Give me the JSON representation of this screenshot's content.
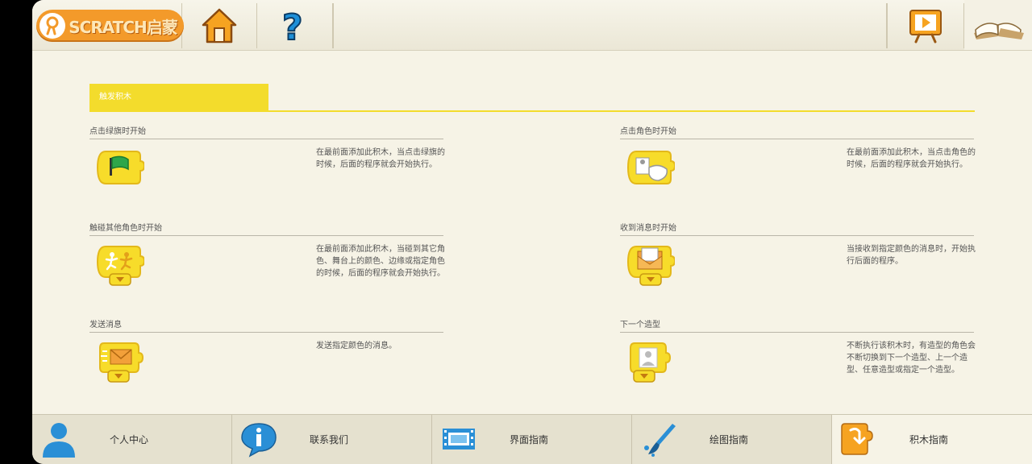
{
  "topbar": {
    "logo_text": "SCRATCH启蒙",
    "home_icon": "home-icon",
    "help_icon": "help-icon",
    "video_icon": "video-icon",
    "book_icon": "book-icon"
  },
  "section": {
    "title": "触发积木"
  },
  "blocks": [
    {
      "title": "点击绿旗时开始",
      "desc": "在最前面添加此积木，当点击绿旗的时候，后面的程序就会开始执行。",
      "icon": "green-flag-block-icon"
    },
    {
      "title": "点击角色时开始",
      "desc": "在最前面添加此积木，当点击角色的时候，后面的程序就会开始执行。",
      "icon": "tap-sprite-block-icon"
    },
    {
      "title": "触碰其他角色时开始",
      "desc": "在最前面添加此积木，当碰到其它角色、舞台上的颜色、边缘或指定角色的时候，后面的程序就会开始执行。",
      "icon": "bump-block-icon"
    },
    {
      "title": "收到消息时开始",
      "desc": "当接收到指定颜色的消息时，开始执行后面的程序。",
      "icon": "receive-message-block-icon"
    },
    {
      "title": "发送消息",
      "desc": "发送指定颜色的消息。",
      "icon": "send-message-block-icon"
    },
    {
      "title": "下一个造型",
      "desc": "不断执行该积木时，有造型的角色会不断切换到下一个造型、上一个造型、任意造型或指定一个造型。",
      "icon": "next-costume-block-icon"
    }
  ],
  "bottom_nav": [
    {
      "label": "个人中心",
      "icon": "user-icon"
    },
    {
      "label": "联系我们",
      "icon": "info-icon"
    },
    {
      "label": "界面指南",
      "icon": "film-icon"
    },
    {
      "label": "绘图指南",
      "icon": "paintbrush-icon"
    },
    {
      "label": "积木指南",
      "icon": "block-guide-icon"
    }
  ],
  "colors": {
    "accent_yellow": "#f3dc2c",
    "orange": "#f39a2a",
    "blue": "#2a8fd6"
  }
}
